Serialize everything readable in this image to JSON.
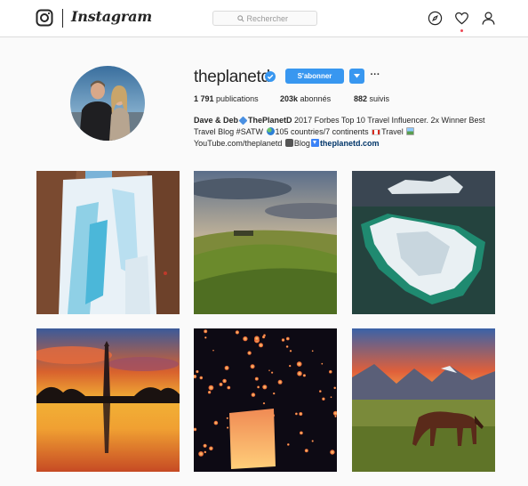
{
  "nav": {
    "brand": "Instagram",
    "search_placeholder": "Rechercher",
    "icons": [
      "instagram-glyph-icon",
      "search-icon",
      "explore-compass-icon",
      "activity-heart-icon",
      "profile-person-icon"
    ]
  },
  "profile": {
    "username": "theplanetd",
    "verified": true,
    "follow_label": "S'abonner",
    "more_label": "···",
    "stats": [
      {
        "value": "1 791",
        "label": "publications"
      },
      {
        "value": "203k",
        "label": "abonnés"
      },
      {
        "value": "882",
        "label": "suivis"
      }
    ],
    "bio": {
      "name": "Dave & Deb",
      "name2": "ThePlanetD",
      "text1": " 2017 Forbes Top 10 Travel Influencer. 2x Winner Best Travel Blog #SATW ",
      "text2": "105 countries/7 continents ",
      "text3": "Travel ",
      "text4": "YouTube.com/theplanetd ",
      "text5": "Blog",
      "link": "theplanetd.com"
    }
  },
  "posts": [
    {
      "name": "frozen-waterfall"
    },
    {
      "name": "vineyard-hills"
    },
    {
      "name": "iceberg-aerial"
    },
    {
      "name": "monument-sunset-reflection"
    },
    {
      "name": "sky-lanterns-night"
    },
    {
      "name": "horse-mountain-sunset"
    }
  ],
  "colors": {
    "accent": "#3897f0",
    "background": "#fafafa",
    "text": "#262626",
    "link": "#003569",
    "notification": "#ed4956"
  }
}
